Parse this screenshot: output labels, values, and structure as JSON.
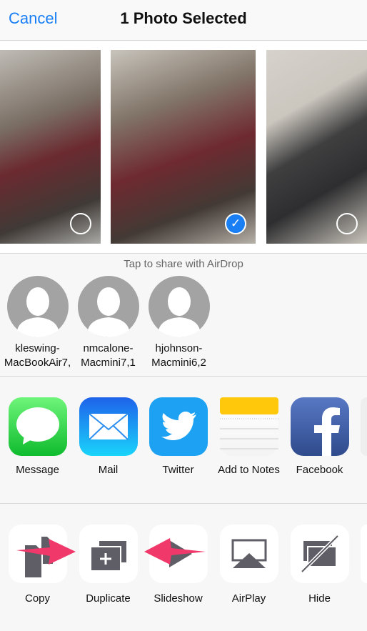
{
  "nav": {
    "cancel": "Cancel",
    "title": "1 Photo Selected"
  },
  "photos": [
    {
      "selected": false
    },
    {
      "selected": true
    },
    {
      "selected": false
    }
  ],
  "airdrop": {
    "title": "Tap to share with AirDrop",
    "peers": [
      {
        "line1": "kleswing-",
        "line2": "MacBookAir7,"
      },
      {
        "line1": "nmcalone-",
        "line2": "Macmini7,1"
      },
      {
        "line1": "hjohnson-",
        "line2": "Macmini6,2"
      }
    ]
  },
  "apps": [
    {
      "label": "Message",
      "icon": "message-icon"
    },
    {
      "label": "Mail",
      "icon": "mail-icon"
    },
    {
      "label": "Twitter",
      "icon": "twitter-icon"
    },
    {
      "label": "Add to Notes",
      "icon": "notes-icon"
    },
    {
      "label": "Facebook",
      "icon": "facebook-icon"
    }
  ],
  "actions": [
    {
      "label": "Copy",
      "icon": "copy-icon"
    },
    {
      "label": "Duplicate",
      "icon": "duplicate-icon"
    },
    {
      "label": "Slideshow",
      "icon": "slideshow-icon"
    },
    {
      "label": "AirPlay",
      "icon": "airplay-icon"
    },
    {
      "label": "Hide",
      "icon": "hide-icon"
    }
  ],
  "colors": {
    "accent": "#1a7ff5",
    "annotation_arrow": "#f0386b",
    "action_glyph": "#5f5e66"
  }
}
